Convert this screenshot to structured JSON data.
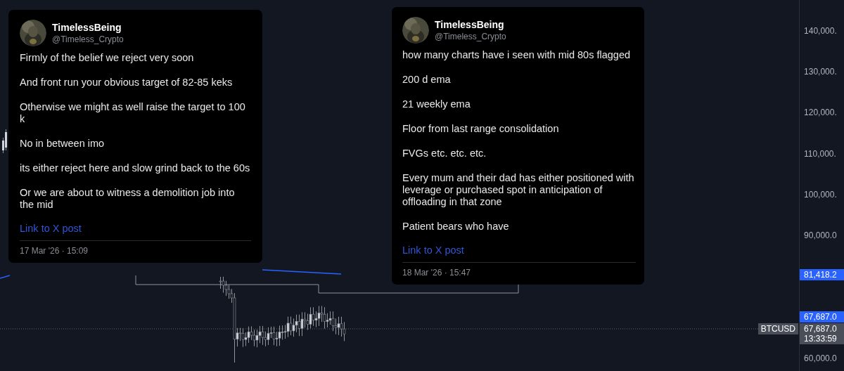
{
  "posts": [
    {
      "author": "TimelessBeing",
      "handle": "@Timeless_Crypto",
      "paragraphs": [
        "Firmly of the belief we reject very soon",
        "And front run your obvious target of 82-85 keks",
        "Otherwise we might as well raise the target to 100 k",
        "No in between imo",
        "its either reject here and slow grind back to the 60s",
        "Or we are about to witness a demolition job into the mid"
      ],
      "link": "Link to X post",
      "timestamp": "17 Mar '26 · 15:09"
    },
    {
      "author": "TimelessBeing",
      "handle": "@Timeless_Crypto",
      "paragraphs": [
        "how many charts have i seen with mid 80s flagged",
        "200 d ema",
        "21 weekly ema",
        "Floor from last range consolidation",
        "FVGs etc. etc. etc.",
        "Every mum and their dad has either positioned with leverage or purchased spot in anticipation of offloading in that zone",
        "Patient bears who have"
      ],
      "link": "Link to X post",
      "timestamp": "18 Mar '26 · 15:47"
    }
  ],
  "price_axis": {
    "ticks": [
      "140,000.",
      "130,000.",
      "120,000.",
      "110,000.",
      "100,000.",
      "90,000.0",
      "60,000.0"
    ],
    "labels": [
      {
        "kind": "highlight",
        "text": "81,418.2"
      },
      {
        "kind": "highlight",
        "text": "67,687.0"
      },
      {
        "kind": "last",
        "text": "67,687.0",
        "countdown": "13:33:59"
      }
    ]
  },
  "symbol": "BTCUSD"
}
